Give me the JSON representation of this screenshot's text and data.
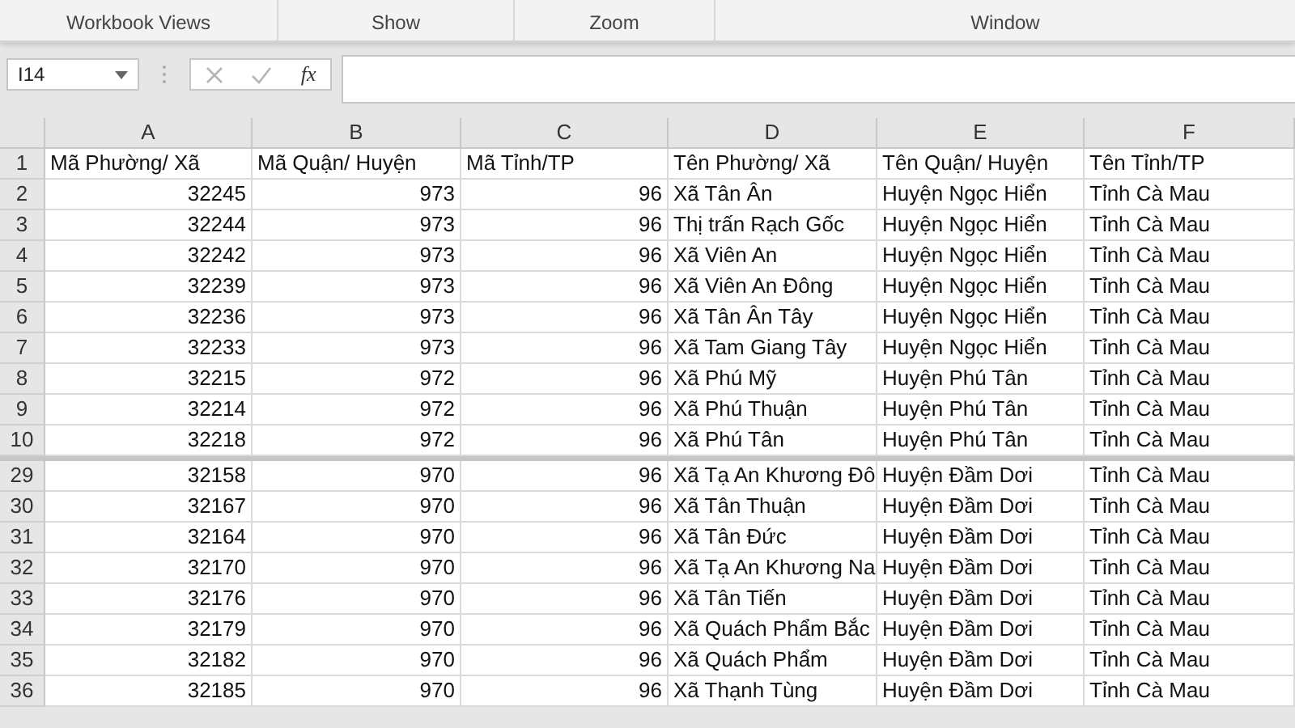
{
  "ribbon": {
    "groups": [
      {
        "label": "Workbook Views"
      },
      {
        "label": "Show"
      },
      {
        "label": "Zoom"
      },
      {
        "label": "Window"
      }
    ]
  },
  "formula_bar": {
    "name_box": "I14",
    "function_label": "fx",
    "cancel_disabled": true,
    "enter_disabled": true
  },
  "sheet": {
    "columns": [
      {
        "label": "A"
      },
      {
        "label": "B"
      },
      {
        "label": "C"
      },
      {
        "label": "D"
      },
      {
        "label": "E"
      },
      {
        "label": "F"
      }
    ],
    "header_row": {
      "number": "1",
      "cells": [
        "Mã Phường/ Xã",
        "Mã Quận/ Huyện",
        "Mã Tỉnh/TP",
        "Tên Phường/ Xã",
        "Tên Quận/ Huyện",
        "Tên Tỉnh/TP"
      ]
    },
    "top_rows": [
      {
        "number": "2",
        "cells": [
          "32245",
          "973",
          "96",
          "Xã Tân Ân",
          "Huyện Ngọc Hiển",
          "Tỉnh Cà Mau"
        ]
      },
      {
        "number": "3",
        "cells": [
          "32244",
          "973",
          "96",
          "Thị trấn Rạch Gốc",
          "Huyện Ngọc Hiển",
          "Tỉnh Cà Mau"
        ]
      },
      {
        "number": "4",
        "cells": [
          "32242",
          "973",
          "96",
          "Xã Viên An",
          "Huyện Ngọc Hiển",
          "Tỉnh Cà Mau"
        ]
      },
      {
        "number": "5",
        "cells": [
          "32239",
          "973",
          "96",
          "Xã Viên An Đông",
          "Huyện Ngọc Hiển",
          "Tỉnh Cà Mau"
        ]
      },
      {
        "number": "6",
        "cells": [
          "32236",
          "973",
          "96",
          "Xã Tân Ân Tây",
          "Huyện Ngọc Hiển",
          "Tỉnh Cà Mau"
        ]
      },
      {
        "number": "7",
        "cells": [
          "32233",
          "973",
          "96",
          "Xã Tam Giang Tây",
          "Huyện Ngọc Hiển",
          "Tỉnh Cà Mau"
        ]
      },
      {
        "number": "8",
        "cells": [
          "32215",
          "972",
          "96",
          "Xã Phú Mỹ",
          "Huyện Phú Tân",
          "Tỉnh Cà Mau"
        ]
      },
      {
        "number": "9",
        "cells": [
          "32214",
          "972",
          "96",
          "Xã Phú Thuận",
          "Huyện Phú Tân",
          "Tỉnh Cà Mau"
        ]
      },
      {
        "number": "10",
        "cells": [
          "32218",
          "972",
          "96",
          "Xã Phú Tân",
          "Huyện Phú Tân",
          "Tỉnh Cà Mau"
        ]
      }
    ],
    "bottom_rows": [
      {
        "number": "29",
        "cells": [
          "32158",
          "970",
          "96",
          "Xã Tạ An Khương  Đô",
          "Huyện Đầm Dơi",
          "Tỉnh Cà Mau"
        ]
      },
      {
        "number": "30",
        "cells": [
          "32167",
          "970",
          "96",
          "Xã Tân Thuận",
          "Huyện Đầm Dơi",
          "Tỉnh Cà Mau"
        ]
      },
      {
        "number": "31",
        "cells": [
          "32164",
          "970",
          "96",
          "Xã Tân Đức",
          "Huyện Đầm Dơi",
          "Tỉnh Cà Mau"
        ]
      },
      {
        "number": "32",
        "cells": [
          "32170",
          "970",
          "96",
          "Xã Tạ An Khương  Na",
          "Huyện Đầm Dơi",
          "Tỉnh Cà Mau"
        ]
      },
      {
        "number": "33",
        "cells": [
          "32176",
          "970",
          "96",
          "Xã Tân Tiến",
          "Huyện Đầm Dơi",
          "Tỉnh Cà Mau"
        ]
      },
      {
        "number": "34",
        "cells": [
          "32179",
          "970",
          "96",
          "Xã Quách Phẩm Bắc",
          "Huyện Đầm Dơi",
          "Tỉnh Cà Mau"
        ]
      },
      {
        "number": "35",
        "cells": [
          "32182",
          "970",
          "96",
          "Xã Quách Phẩm",
          "Huyện Đầm Dơi",
          "Tỉnh Cà Mau"
        ]
      },
      {
        "number": "36",
        "cells": [
          "32185",
          "970",
          "96",
          "Xã Thạnh Tùng",
          "Huyện Đầm Dơi",
          "Tỉnh Cà Mau"
        ]
      }
    ]
  }
}
